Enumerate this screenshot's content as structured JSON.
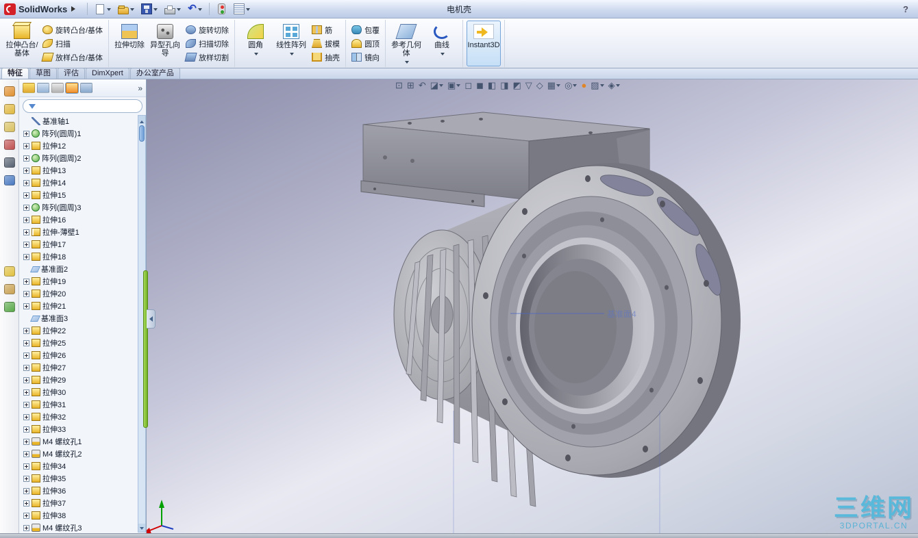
{
  "titlebar": {
    "app_name": "SolidWorks",
    "document_title": "电机壳",
    "help_label": "?",
    "undo_glyph": "↶"
  },
  "command_tabs": [
    {
      "id": "features",
      "label": "特征",
      "active": true
    },
    {
      "id": "sketch",
      "label": "草图",
      "active": false
    },
    {
      "id": "evaluate",
      "label": "评估",
      "active": false
    },
    {
      "id": "dimxpert",
      "label": "DimXpert",
      "active": false
    },
    {
      "id": "office-products",
      "label": "办公室产品",
      "active": false
    }
  ],
  "ribbon": {
    "groups": [
      {
        "items": [
          {
            "type": "big",
            "id": "extrude-boss",
            "icon": "extrude-boss",
            "label": "拉伸凸台/基体"
          },
          {
            "type": "stack",
            "buttons": [
              {
                "id": "revolve-boss",
                "icon": "revolve-boss",
                "label": "旋转凸台/基体"
              },
              {
                "id": "sweep",
                "icon": "sweep",
                "label": "扫描"
              },
              {
                "id": "loft-boss",
                "icon": "loft",
                "label": "放样凸台/基体"
              }
            ]
          }
        ]
      },
      {
        "items": [
          {
            "type": "big",
            "id": "extruded-cut",
            "icon": "extruded-cut",
            "label": "拉伸切除"
          },
          {
            "type": "big",
            "id": "hole-wizard",
            "icon": "hole-wizard",
            "label": "异型孔向导"
          },
          {
            "type": "stack",
            "buttons": [
              {
                "id": "revolve-cut",
                "icon": "revolve-cut",
                "label": "旋转切除"
              },
              {
                "id": "sweep-cut",
                "icon": "sweep-cut",
                "label": "扫描切除"
              },
              {
                "id": "loft-cut",
                "icon": "loft-cut",
                "label": "放样切割"
              }
            ]
          }
        ]
      },
      {
        "items": [
          {
            "type": "big",
            "id": "fillet",
            "icon": "fillet",
            "label": "圆角",
            "dropdown": true
          },
          {
            "type": "big",
            "id": "linear-pattern",
            "icon": "linear-pattern",
            "label": "线性阵列",
            "dropdown": true
          },
          {
            "type": "stack",
            "buttons": [
              {
                "id": "rib",
                "icon": "rib",
                "label": "筋"
              },
              {
                "id": "draft",
                "icon": "draft",
                "label": "拔模"
              },
              {
                "id": "shell",
                "icon": "shell",
                "label": "抽壳"
              }
            ]
          }
        ]
      },
      {
        "items": [
          {
            "type": "stack",
            "buttons": [
              {
                "id": "wrap",
                "icon": "wrap",
                "label": "包覆"
              },
              {
                "id": "dome",
                "icon": "dome",
                "label": "圆顶"
              },
              {
                "id": "mirror",
                "icon": "mirror",
                "label": "镜向"
              }
            ]
          }
        ]
      },
      {
        "items": [
          {
            "type": "big",
            "id": "reference-geometry",
            "icon": "reference-geometry",
            "label": "参考几何体",
            "dropdown": true
          },
          {
            "type": "big",
            "id": "curves",
            "icon": "curves",
            "label": "曲线",
            "dropdown": true
          }
        ]
      },
      {
        "items": [
          {
            "type": "big",
            "id": "instant3d",
            "icon": "instant3d",
            "label": "Instant3D",
            "selected": true
          }
        ]
      }
    ]
  },
  "headsup": {
    "icons": [
      {
        "name": "zoom-to-fit-icon",
        "glyph": "⊡"
      },
      {
        "name": "zoom-to-area-icon",
        "glyph": "⊞"
      },
      {
        "name": "previous-view-icon",
        "glyph": "↶"
      },
      {
        "name": "section-view-icon",
        "glyph": "◪",
        "dropdown": true
      },
      {
        "name": "view-orientation-icon",
        "glyph": "▣",
        "dropdown": true
      },
      {
        "name": "front-view-icon",
        "glyph": "◻"
      },
      {
        "name": "back-view-icon",
        "glyph": "◼"
      },
      {
        "name": "left-view-icon",
        "glyph": "◧"
      },
      {
        "name": "right-view-icon",
        "glyph": "◨"
      },
      {
        "name": "top-view-icon",
        "glyph": "◩"
      },
      {
        "name": "bottom-view-icon",
        "glyph": "▽"
      },
      {
        "name": "isometric-view-icon",
        "glyph": "◇"
      },
      {
        "name": "display-style-icon",
        "glyph": "▦",
        "dropdown": true
      },
      {
        "name": "hide-show-items-icon",
        "glyph": "◎",
        "dropdown": true
      },
      {
        "name": "edit-appearance-icon",
        "glyph": "●",
        "color": "#e08428"
      },
      {
        "name": "apply-scene-icon",
        "glyph": "▨",
        "dropdown": true
      },
      {
        "name": "view-settings-icon",
        "glyph": "◈",
        "dropdown": true
      }
    ]
  },
  "left_toolbar": {
    "top": [
      {
        "name": "tool-icon-1",
        "color": "#e09030"
      },
      {
        "name": "tool-icon-2",
        "color": "#e0b840"
      },
      {
        "name": "tool-icon-3",
        "color": "#d8c060"
      },
      {
        "name": "tool-icon-4",
        "color": "#c05050"
      },
      {
        "name": "tool-icon-5",
        "color": "#556070"
      },
      {
        "name": "tool-icon-6",
        "color": "#4878c0"
      }
    ],
    "middle": [
      {
        "name": "tool-icon-7",
        "color": "#e0c040"
      },
      {
        "name": "tool-icon-8",
        "color": "#c8a050"
      },
      {
        "name": "tool-icon-9",
        "color": "#58a848"
      }
    ]
  },
  "feature_panel": {
    "overflow_glyph": "»",
    "filter_placeholder": "",
    "header_icons": [
      {
        "name": "featuremanager-tab-icon",
        "active": false
      },
      {
        "name": "propertymanager-tab-icon",
        "active": false
      },
      {
        "name": "configurationmanager-tab-icon",
        "active": false
      },
      {
        "name": "dimxpertmanager-tab-icon",
        "active": true
      },
      {
        "name": "displaymanager-tab-icon",
        "active": false
      }
    ],
    "tree": [
      {
        "label": "基准轴1",
        "icon": "axis",
        "expandable": false
      },
      {
        "label": "阵列(圆周)1",
        "icon": "circular-pattern",
        "expandable": true
      },
      {
        "label": "拉伸12",
        "icon": "extrude",
        "expandable": true
      },
      {
        "label": "阵列(圆周)2",
        "icon": "circular-pattern",
        "expandable": true
      },
      {
        "label": "拉伸13",
        "icon": "extrude",
        "expandable": true
      },
      {
        "label": "拉伸14",
        "icon": "extrude",
        "expandable": true
      },
      {
        "label": "拉伸15",
        "icon": "extrude",
        "expandable": true
      },
      {
        "label": "阵列(圆周)3",
        "icon": "circular-pattern",
        "expandable": true
      },
      {
        "label": "拉伸16",
        "icon": "extrude",
        "expandable": true
      },
      {
        "label": "拉伸-薄壁1",
        "icon": "extrude-thin",
        "expandable": true
      },
      {
        "label": "拉伸17",
        "icon": "extrude",
        "expandable": true
      },
      {
        "label": "拉伸18",
        "icon": "extrude",
        "expandable": true
      },
      {
        "label": "基准面2",
        "icon": "plane",
        "expandable": false
      },
      {
        "label": "拉伸19",
        "icon": "extrude",
        "expandable": true
      },
      {
        "label": "拉伸20",
        "icon": "extrude",
        "expandable": true
      },
      {
        "label": "拉伸21",
        "icon": "extrude",
        "expandable": true
      },
      {
        "label": "基准面3",
        "icon": "plane",
        "expandable": false
      },
      {
        "label": "拉伸22",
        "icon": "extrude",
        "expandable": true
      },
      {
        "label": "拉伸25",
        "icon": "extrude",
        "expandable": true
      },
      {
        "label": "拉伸26",
        "icon": "extrude",
        "expandable": true
      },
      {
        "label": "拉伸27",
        "icon": "extrude",
        "expandable": true
      },
      {
        "label": "拉伸29",
        "icon": "extrude",
        "expandable": true
      },
      {
        "label": "拉伸30",
        "icon": "extrude",
        "expandable": true
      },
      {
        "label": "拉伸31",
        "icon": "extrude",
        "expandable": true
      },
      {
        "label": "拉伸32",
        "icon": "extrude",
        "expandable": true
      },
      {
        "label": "拉伸33",
        "icon": "extrude",
        "expandable": true
      },
      {
        "label": "M4 螺纹孔1",
        "icon": "hole",
        "expandable": true
      },
      {
        "label": "M4 螺纹孔2",
        "icon": "hole",
        "expandable": true
      },
      {
        "label": "拉伸34",
        "icon": "extrude",
        "expandable": true
      },
      {
        "label": "拉伸35",
        "icon": "extrude",
        "expandable": true
      },
      {
        "label": "拉伸36",
        "icon": "extrude",
        "expandable": true
      },
      {
        "label": "拉伸37",
        "icon": "extrude",
        "expandable": true
      },
      {
        "label": "拉伸38",
        "icon": "extrude",
        "expandable": true
      },
      {
        "label": "M4 螺纹孔3",
        "icon": "hole",
        "expandable": true
      }
    ]
  },
  "viewport": {
    "datum_label": "基准面4",
    "watermark_line1": "三维网",
    "watermark_line2": "3DPORTAL.CN"
  },
  "colors": {
    "splitter_green": "#8dc63f",
    "accent_blue": "#2a6ad0",
    "watermark_cyan": "#29b2dc"
  }
}
